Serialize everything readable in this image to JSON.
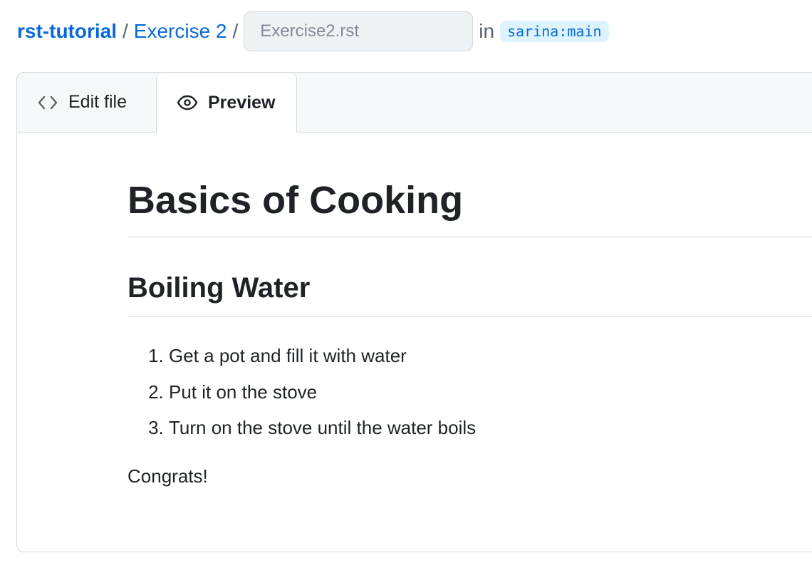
{
  "breadcrumb": {
    "repo": "rst-tutorial",
    "separator": "/",
    "folder": "Exercise 2",
    "filename_value": "",
    "filename_placeholder": "Exercise2.rst",
    "in_label": "in",
    "branch": "sarina:main"
  },
  "tabs": {
    "edit_label": "Edit file",
    "preview_label": "Preview",
    "active": "preview"
  },
  "preview": {
    "title": "Basics of Cooking",
    "section_heading": "Boiling Water",
    "steps": [
      "Get a pot and fill it with water",
      "Put it on the stove",
      "Turn on the stove until the water boils"
    ],
    "closing": "Congrats!"
  },
  "colors": {
    "link": "#0969da",
    "branch_bg": "#ddf4ff",
    "border": "#d1d9e0",
    "tabbar_bg": "#f6f8fa",
    "text": "#1f2328"
  },
  "icons": {
    "edit_tab": "code-brackets-icon",
    "preview_tab": "eye-icon"
  }
}
